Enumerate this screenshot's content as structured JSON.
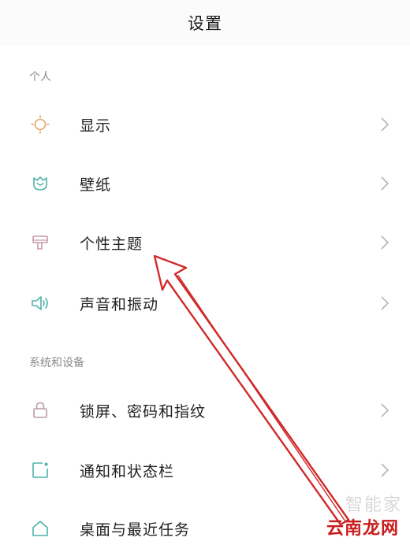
{
  "header": {
    "title": "设置"
  },
  "sections": [
    {
      "title": "个人"
    },
    {
      "title": "系统和设备"
    }
  ],
  "items": [
    {
      "label": "显示",
      "icon": "display-brightness-icon",
      "color": "#e3a86c"
    },
    {
      "label": "壁纸",
      "icon": "wallpaper-tulip-icon",
      "color": "#4fb3a9"
    },
    {
      "label": "个性主题",
      "icon": "theme-brush-icon",
      "color": "#c89aa8"
    },
    {
      "label": "声音和振动",
      "icon": "sound-speaker-icon",
      "color": "#4fb3a9"
    },
    {
      "label": "锁屏、密码和指纹",
      "icon": "lock-icon",
      "color": "#b89aa6"
    },
    {
      "label": "通知和状态栏",
      "icon": "notification-icon",
      "color": "#4fb3a9"
    },
    {
      "label": "桌面与最近任务",
      "icon": "home-icon",
      "color": "#4fb3a9"
    }
  ],
  "watermark": {
    "site": "云南龙网",
    "faded": "智能家"
  },
  "annotation": {
    "color": "#d02a2a"
  }
}
